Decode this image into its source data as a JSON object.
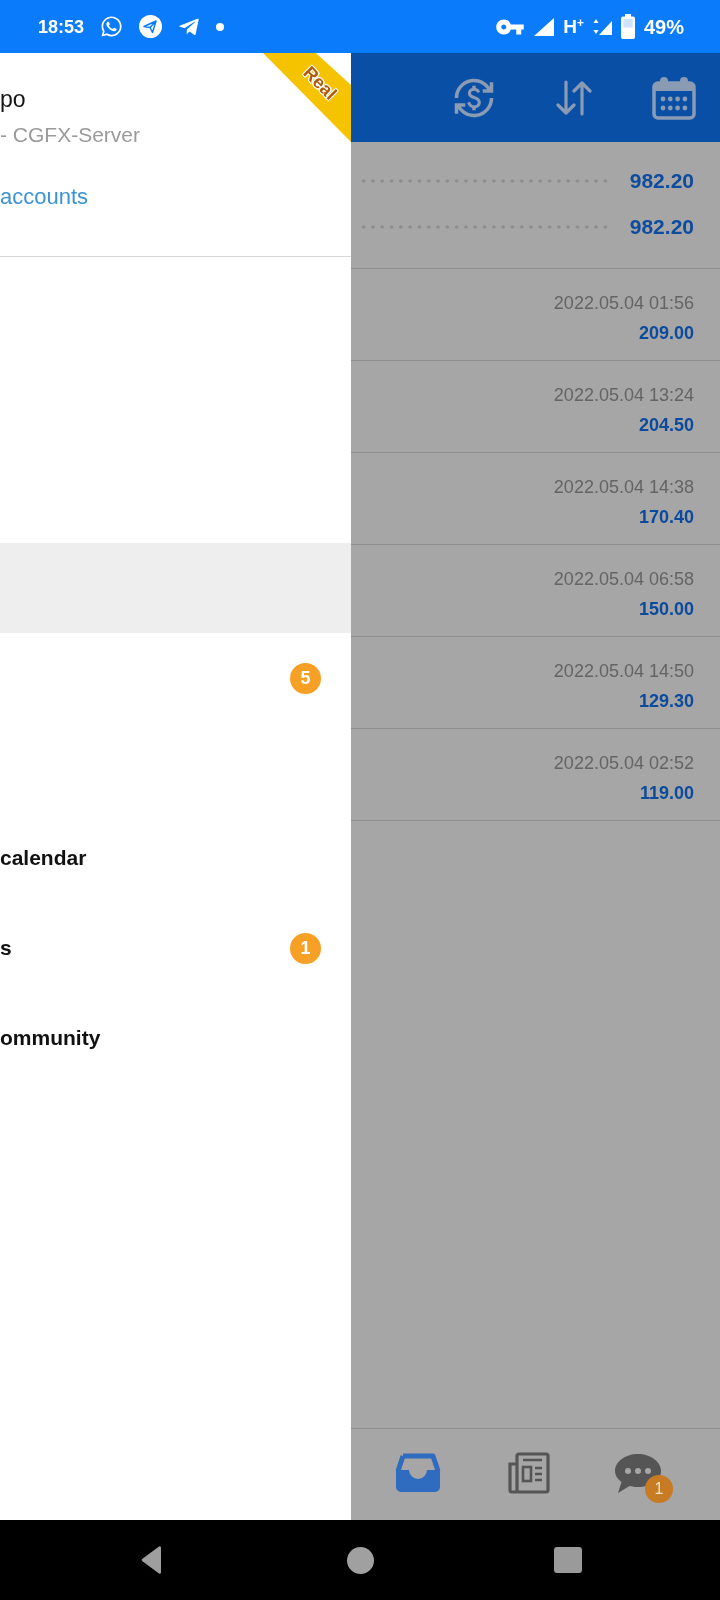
{
  "status_bar": {
    "time": "18:53",
    "network": "H$^{+}$",
    "battery": "49%"
  },
  "drawer": {
    "account": {
      "name": "po",
      "server": "- CGFX-Server",
      "link": "accounts",
      "ribbon": "Real"
    },
    "sections": [
      {
        "items": [
          {
            "selected": true
          },
          {
            "selected": false,
            "badge": "5"
          }
        ]
      },
      {
        "items": [
          {
            "label": "calendar",
            "selected": false
          },
          {
            "label": "s",
            "selected": false,
            "badge": "1"
          },
          {
            "label": "ommunity",
            "selected": false
          }
        ]
      }
    ]
  },
  "trade": {
    "summary": [
      {
        "value": "982.20"
      },
      {
        "value": "982.20"
      }
    ],
    "deals": [
      {
        "time": "2022.05.04 01:56",
        "profit": "209.00"
      },
      {
        "time": "2022.05.04 13:24",
        "profit": "204.50"
      },
      {
        "time": "2022.05.04 14:38",
        "profit": "170.40"
      },
      {
        "time": "2022.05.04 06:58",
        "profit": "150.00"
      },
      {
        "time": "2022.05.04 14:50",
        "profit": "129.30"
      },
      {
        "time": "2022.05.04 02:52",
        "profit": "119.00"
      }
    ],
    "bottom_tabs": [
      {
        "selected": true
      },
      {
        "selected": false
      },
      {
        "selected": false,
        "badge": "1"
      }
    ]
  }
}
